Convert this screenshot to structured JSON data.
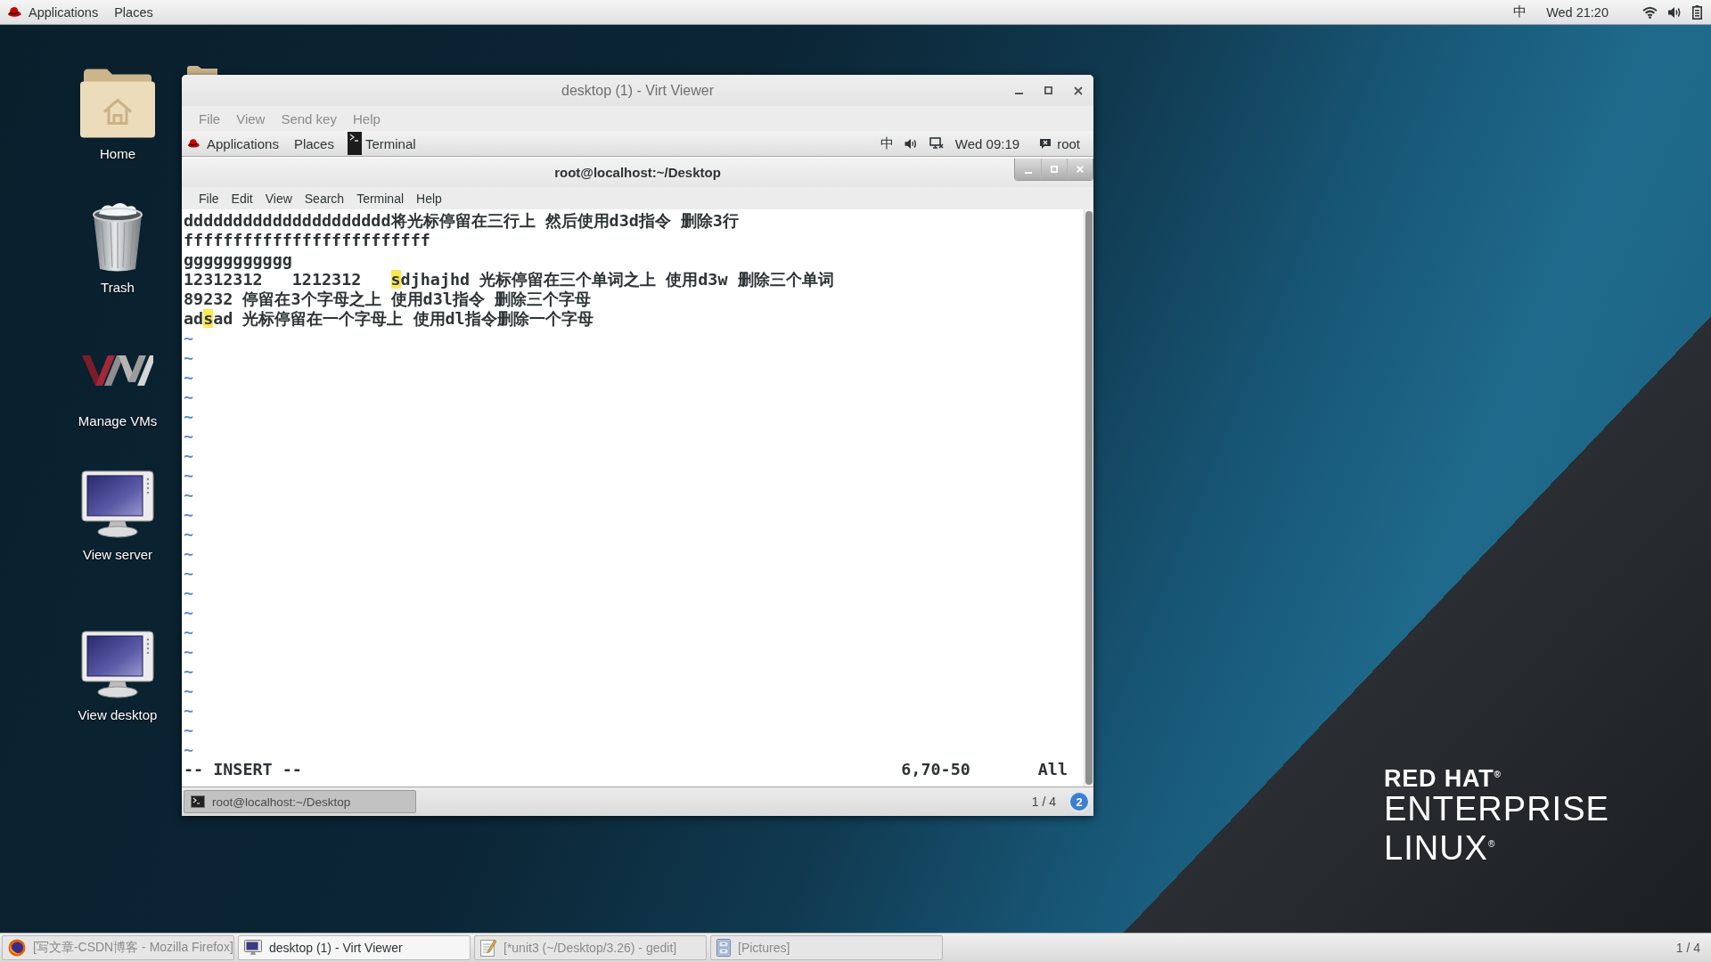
{
  "top_bar": {
    "menus": [
      "Applications",
      "Places"
    ],
    "input_method": "中",
    "clock": "Wed 21:20"
  },
  "desktop_icons": [
    {
      "label": "Home",
      "kind": "home"
    },
    {
      "label": "Trash",
      "kind": "trash"
    },
    {
      "label": "Manage VMs",
      "kind": "vm"
    },
    {
      "label": "View server",
      "kind": "monitor"
    },
    {
      "label": "View desktop",
      "kind": "monitor"
    }
  ],
  "viewer_window": {
    "title": "desktop (1) - Virt Viewer",
    "menu": [
      "File",
      "View",
      "Send key",
      "Help"
    ],
    "guest_top_bar": {
      "menus": [
        "Applications",
        "Places"
      ],
      "window_button": "Terminal",
      "input_method": "中",
      "clock": "Wed 09:19",
      "user": "root"
    },
    "terminal": {
      "title": "root@localhost:~/Desktop",
      "menu": [
        "File",
        "Edit",
        "View",
        "Search",
        "Terminal",
        "Help"
      ],
      "lines": [
        {
          "segments": [
            {
              "text": "ddddddddddddddddddddd将光标停留在三行上 然后使用d3d指令 删除3行",
              "highlighted": false
            }
          ]
        },
        {
          "segments": [
            {
              "text": "fffffffffffffffffffffffff",
              "highlighted": false
            }
          ]
        },
        {
          "segments": [
            {
              "text": "ggggggggggg",
              "highlighted": false
            }
          ]
        },
        {
          "segments": [
            {
              "text": "12312312   1212312   ",
              "highlighted": false
            },
            {
              "text": "s",
              "highlighted": true
            },
            {
              "text": "djhajhd 光标停留在三个单词之上 使用d3w 删除三个单词",
              "highlighted": false
            }
          ]
        },
        {
          "segments": [
            {
              "text": "89232 停留在3个字母之上 使用d3l指令 删除三个字母",
              "highlighted": false
            }
          ]
        },
        {
          "segments": [
            {
              "text": "ad",
              "highlighted": false
            },
            {
              "text": "s",
              "highlighted": true
            },
            {
              "text": "ad 光标停留在一个字母上 使用dl指令删除一个字母",
              "highlighted": false
            }
          ]
        }
      ],
      "tildes": [
        "~",
        "~",
        "~",
        "~",
        "~",
        "~",
        "~",
        "~",
        "~",
        "~",
        "~",
        "~",
        "~",
        "~",
        "~",
        "~",
        "~",
        "~",
        "~",
        "~",
        "~",
        "~"
      ],
      "mode": "-- INSERT --",
      "position": "6,70-50",
      "scroll": "All"
    },
    "guest_taskbar": {
      "windows": [
        {
          "label": "root@localhost:~/Desktop",
          "selected": true
        }
      ],
      "workspace": "1 / 4",
      "notifications": "2"
    }
  },
  "taskbar": {
    "windows": [
      {
        "label": "[写文章-CSDN博客 - Mozilla Firefox]",
        "kind": "browser",
        "selected": false
      },
      {
        "label": "desktop (1) - Virt Viewer",
        "kind": "viewer",
        "selected": true
      },
      {
        "label": "[*unit3 (~/Desktop/3.26) - gedit]",
        "kind": "editor",
        "selected": false
      },
      {
        "label": "[Pictures]",
        "kind": "files",
        "selected": false
      }
    ],
    "workspace": "1 / 4"
  },
  "branding": [
    {
      "text": "RED HAT$^{®}$",
      "kind": "brand"
    },
    {
      "text": "ENTERPRISE",
      "kind": "product"
    },
    {
      "text": "LINUX$^{®}$",
      "kind": "product"
    }
  ]
}
